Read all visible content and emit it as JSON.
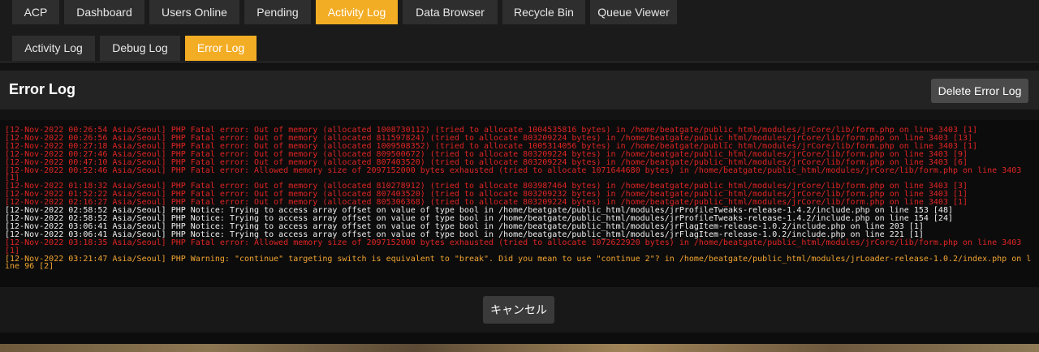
{
  "main_tabs": [
    "ACP",
    "Dashboard",
    "Users Online",
    "Pending",
    "Activity Log",
    "Data Browser",
    "Recycle Bin",
    "Queue Viewer"
  ],
  "main_active": "Activity Log",
  "sub_tabs": [
    "Activity Log",
    "Debug Log",
    "Error Log"
  ],
  "sub_active": "Error Log",
  "page_title": "Error Log",
  "delete_label": "Delete Error Log",
  "cancel_label": "キャンセル",
  "colors": {
    "accent": "#f3ad25",
    "error": "#e02424",
    "notice": "#f0f0f0",
    "warning": "#f3a632"
  },
  "log_lines": [
    {
      "level": "error",
      "text": "[12-Nov-2022 00:26:54 Asia/Seoul] PHP Fatal error: Out of memory (allocated 1008730112) (tried to allocate 1004535816 bytes) in /home/beatgate/public_html/modules/jrCore/lib/form.php on line 3403 [1]"
    },
    {
      "level": "error",
      "text": "[12-Nov-2022 00:26:56 Asia/Seoul] PHP Fatal error: Out of memory (allocated 811597824) (tried to allocate 803209224 bytes) in /home/beatgate/public_html/modules/jrCore/lib/form.php on line 3403 [13]"
    },
    {
      "level": "error",
      "text": "[12-Nov-2022 00:27:18 Asia/Seoul] PHP Fatal error: Out of memory (allocated 1009508352) (tried to allocate 1005314056 bytes) in /home/beatgate/public_html/modules/jrCore/lib/form.php on line 3403 [1]"
    },
    {
      "level": "error",
      "text": "[12-Nov-2022 00:27:46 Asia/Seoul] PHP Fatal error: Out of memory (allocated 809500672) (tried to allocate 803209224 bytes) in /home/beatgate/public_html/modules/jrCore/lib/form.php on line 3403 [9]"
    },
    {
      "level": "error",
      "text": "[12-Nov-2022 00:47:10 Asia/Seoul] PHP Fatal error: Out of memory (allocated 807403520) (tried to allocate 803209224 bytes) in /home/beatgate/public_html/modules/jrCore/lib/form.php on line 3403 [6]"
    },
    {
      "level": "error",
      "text": "[12-Nov-2022 00:52:46 Asia/Seoul] PHP Fatal error: Allowed memory size of 2097152000 bytes exhausted (tried to allocate 1071644680 bytes) in /home/beatgate/public_html/modules/jrCore/lib/form.php on line 3403 [1]"
    },
    {
      "level": "error",
      "text": "[12-Nov-2022 01:18:32 Asia/Seoul] PHP Fatal error: Out of memory (allocated 810278912) (tried to allocate 803987464 bytes) in /home/beatgate/public_html/modules/jrCore/lib/form.php on line 3403 [3]"
    },
    {
      "level": "error",
      "text": "[12-Nov-2022 01:52:22 Asia/Seoul] PHP Fatal error: Out of memory (allocated 807403520) (tried to allocate 803209232 bytes) in /home/beatgate/public_html/modules/jrCore/lib/form.php on line 3403 [1]"
    },
    {
      "level": "error",
      "text": "[12-Nov-2022 02:16:27 Asia/Seoul] PHP Fatal error: Out of memory (allocated 805306368) (tried to allocate 803209224 bytes) in /home/beatgate/public_html/modules/jrCore/lib/form.php on line 3403 [1]"
    },
    {
      "level": "notice",
      "text": "[12-Nov-2022 02:58:52 Asia/Seoul] PHP Notice: Trying to access array offset on value of type bool in /home/beatgate/public_html/modules/jrProfileTweaks-release-1.4.2/include.php on line 153 [48]"
    },
    {
      "level": "notice",
      "text": "[12-Nov-2022 02:58:52 Asia/Seoul] PHP Notice: Trying to access array offset on value of type bool in /home/beatgate/public_html/modules/jrProfileTweaks-release-1.4.2/include.php on line 154 [24]"
    },
    {
      "level": "notice",
      "text": "[12-Nov-2022 03:06:41 Asia/Seoul] PHP Notice: Trying to access array offset on value of type bool in /home/beatgate/public_html/modules/jrFlagItem-release-1.0.2/include.php on line 203 [1]"
    },
    {
      "level": "notice",
      "text": "[12-Nov-2022 03:06:41 Asia/Seoul] PHP Notice: Trying to access array offset on value of type bool in /home/beatgate/public_html/modules/jrFlagItem-release-1.0.2/include.php on line 221 [1]"
    },
    {
      "level": "error",
      "text": "[12-Nov-2022 03:18:35 Asia/Seoul] PHP Fatal error: Allowed memory size of 2097152000 bytes exhausted (tried to allocate 1072622920 bytes) in /home/beatgate/public_html/modules/jrCore/lib/form.php on line 3403 [1]"
    },
    {
      "level": "warning",
      "text": "[12-Nov-2022 03:21:47 Asia/Seoul] PHP Warning: \"continue\" targeting switch is equivalent to \"break\". Did you mean to use \"continue 2\"? in /home/beatgate/public_html/modules/jrLoader-release-1.0.2/index.php on line 96 [2]"
    }
  ]
}
